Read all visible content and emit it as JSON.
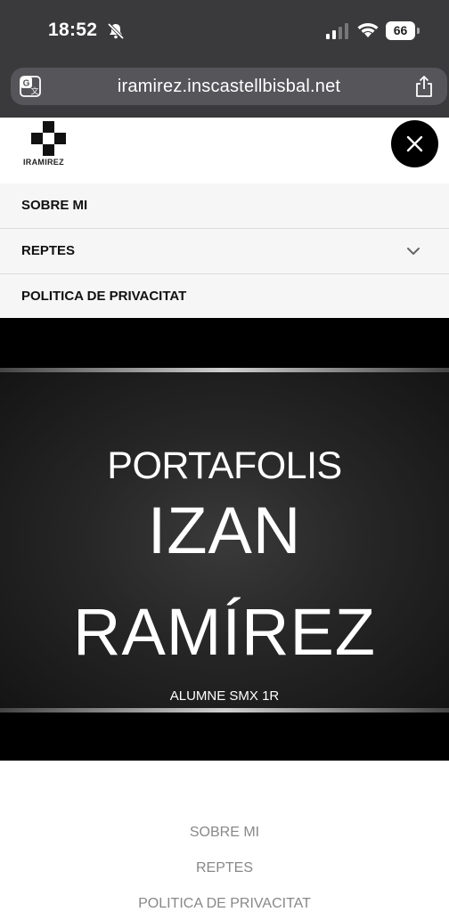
{
  "status_bar": {
    "time": "18:52",
    "battery": "66",
    "icons": [
      "bell-slash-icon",
      "cellular-signal-icon",
      "wifi-icon",
      "battery-icon"
    ]
  },
  "browser": {
    "url": "iramirez.inscastellbisbal.net",
    "icons": [
      "translate-icon",
      "share-icon"
    ]
  },
  "site": {
    "logo_text": "IRAMIREZ",
    "close_icon": "close-icon"
  },
  "nav": {
    "items": [
      {
        "label": "SOBRE MI"
      },
      {
        "label": "REPTES",
        "has_submenu": true
      },
      {
        "label": "POLITICA DE PRIVACITAT"
      }
    ]
  },
  "hero": {
    "title": "PORTAFOLIS",
    "name_line1": "IZAN",
    "name_line2": "RAMÍREZ",
    "subtitle": "ALUMNE SMX 1R"
  },
  "footer": {
    "links": [
      {
        "label": "SOBRE MI"
      },
      {
        "label": "REPTES"
      },
      {
        "label": "POLITICA DE PRIVACITAT"
      }
    ]
  },
  "colors": {
    "chrome": "#3a3a3c",
    "urlbar": "#55555a",
    "nav_bg": "#f6f6f6",
    "hero_bg": "#000000",
    "footer_link": "#888888"
  }
}
